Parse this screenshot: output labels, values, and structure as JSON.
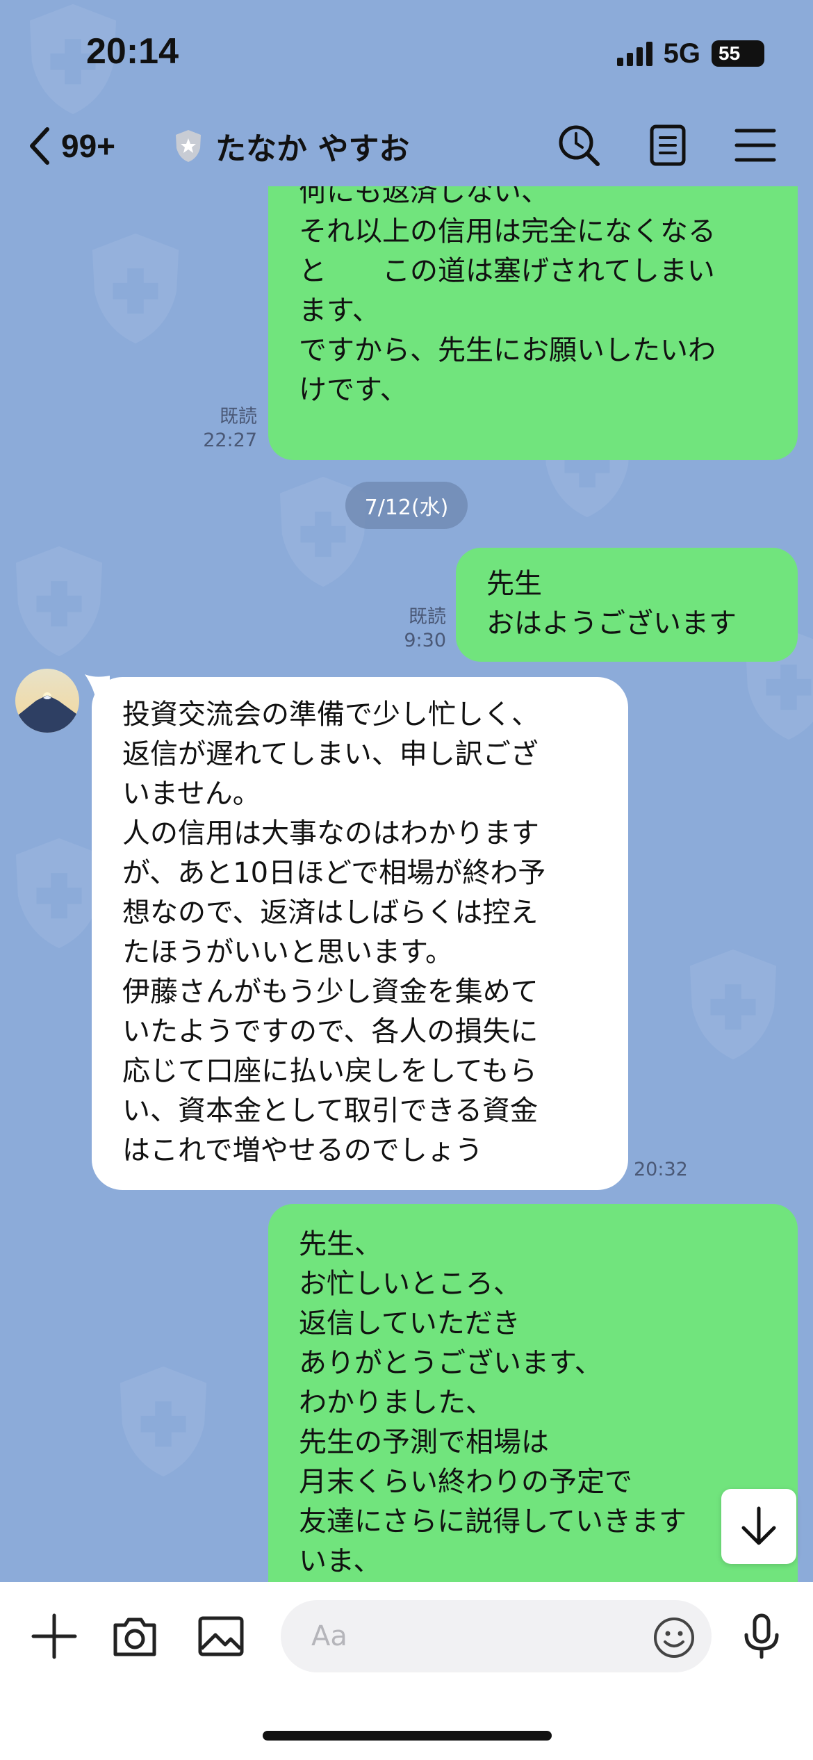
{
  "status": {
    "time": "20:14",
    "network": "5G",
    "battery": "55"
  },
  "header": {
    "back_count": "99+",
    "title": "たなか やすお"
  },
  "messages": {
    "m1": {
      "text": "何にも返済しない、\nそれ以上の信用は完全になくなる\nと　　この道は塞げされてしまい\nます、\nですから、先生にお願いしたいわ\nけです、",
      "read": "既読",
      "time": "22:27"
    },
    "date_separator": "7/12(水)",
    "m2": {
      "text": "先生\nおはようございます",
      "read": "既読",
      "time": "9:30"
    },
    "m3": {
      "text": "投資交流会の準備で少し忙しく、\n返信が遅れてしまい、申し訳ござ\nいません。\n人の信用は大事なのはわかります\nが、あと10日ほどで相場が終わ予\n想なので、返済はしばらくは控え\nたほうがいいと思います。\n伊藤さんがもう少し資金を集めて\nいたようですので、各人の損失に\n応じて口座に払い戻しをしてもら\nい、資本金として取引できる資金\nはこれで増やせるのでしょう",
      "time": "20:32"
    },
    "m4": {
      "text": "先生、\nお忙しいところ、\n返信していただき\nありがとうございます、\nわかりました、\n先生の予測で相場は\n月末くらい終わりの予定で\n友達にさらに説得していきます\nいま、"
    }
  },
  "input": {
    "placeholder": "Aa"
  },
  "icons": {
    "back": "chevron-left-icon",
    "verified": "shield-badge-icon",
    "search": "search-icon",
    "notes": "note-icon",
    "menu": "menu-icon",
    "add": "plus-icon",
    "camera": "camera-icon",
    "image": "image-icon",
    "emoji": "emoji-icon",
    "mic": "mic-icon",
    "scroll": "arrow-down-icon"
  },
  "colors": {
    "background": "#8CABD9",
    "outgoing_bubble": "#71E47D",
    "incoming_bubble": "#FFFFFF"
  }
}
